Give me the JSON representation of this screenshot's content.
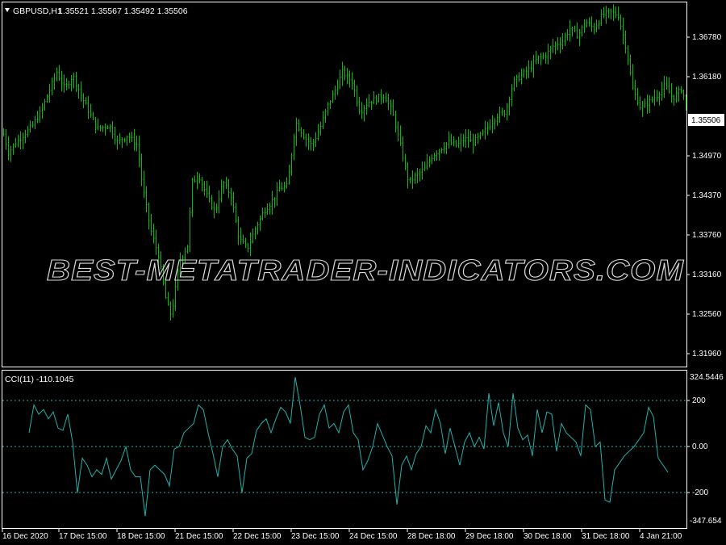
{
  "symbol_header": {
    "title": "GBPUSD,H1",
    "ohlc": "1.35521 1.35567 1.35492 1.35506"
  },
  "watermark": "BEST-METATRADER-INDICATORS.COM",
  "price_axis": {
    "ticks": [
      "1.36780",
      "1.36180",
      "1.34970",
      "1.34370",
      "1.33760",
      "1.33160",
      "1.32560",
      "1.31960"
    ],
    "current_price": "1.35506"
  },
  "indicator": {
    "label": "CCI(11) -110.1045",
    "axis_ticks": [
      "324.5446",
      "200",
      "0.00",
      "-200",
      "-347.654"
    ]
  },
  "time_axis": {
    "ticks": [
      "16 Dec 2020",
      "17 Dec 15:00",
      "18 Dec 15:00",
      "21 Dec 15:00",
      "22 Dec 15:00",
      "23 Dec 15:00",
      "24 Dec 15:00",
      "28 Dec 18:00",
      "29 Dec 18:00",
      "30 Dec 18:00",
      "31 Dec 18:00",
      "4 Jan 21:00"
    ]
  },
  "colors": {
    "background": "#000000",
    "bars": "#00c000",
    "cci_line": "#20b2aa",
    "levels": "#20b2aa",
    "frame": "#ffffff"
  },
  "chart_data": [
    {
      "type": "bar",
      "y_axis_range": [
        1.3166,
        1.3708
      ],
      "close_path": [
        [
          0,
          1.353
        ],
        [
          10,
          1.3485
        ],
        [
          20,
          1.35
        ],
        [
          40,
          1.3525
        ],
        [
          50,
          1.3545
        ],
        [
          60,
          1.3575
        ],
        [
          70,
          1.3605
        ],
        [
          80,
          1.358
        ],
        [
          90,
          1.36
        ],
        [
          100,
          1.357
        ],
        [
          110,
          1.3545
        ],
        [
          120,
          1.352
        ],
        [
          135,
          1.3525
        ],
        [
          145,
          1.35
        ],
        [
          158,
          1.351
        ],
        [
          170,
          1.3495
        ],
        [
          176,
          1.3435
        ],
        [
          186,
          1.337
        ],
        [
          196,
          1.333
        ],
        [
          206,
          1.326
        ],
        [
          212,
          1.324
        ],
        [
          222,
          1.332
        ],
        [
          232,
          1.3345
        ],
        [
          238,
          1.344
        ],
        [
          246,
          1.345
        ],
        [
          256,
          1.342
        ],
        [
          266,
          1.3395
        ],
        [
          276,
          1.344
        ],
        [
          286,
          1.342
        ],
        [
          296,
          1.3355
        ],
        [
          306,
          1.334
        ],
        [
          316,
          1.337
        ],
        [
          326,
          1.3395
        ],
        [
          336,
          1.341
        ],
        [
          346,
          1.343
        ],
        [
          356,
          1.3435
        ],
        [
          366,
          1.353
        ],
        [
          376,
          1.351
        ],
        [
          386,
          1.3495
        ],
        [
          396,
          1.352
        ],
        [
          406,
          1.3555
        ],
        [
          416,
          1.358
        ],
        [
          424,
          1.3605
        ],
        [
          436,
          1.359
        ],
        [
          446,
          1.3545
        ],
        [
          456,
          1.356
        ],
        [
          466,
          1.3565
        ],
        [
          476,
          1.357
        ],
        [
          486,
          1.3545
        ],
        [
          496,
          1.3495
        ],
        [
          506,
          1.344
        ],
        [
          516,
          1.345
        ],
        [
          526,
          1.346
        ],
        [
          536,
          1.348
        ],
        [
          546,
          1.349
        ],
        [
          556,
          1.35
        ],
        [
          566,
          1.3495
        ],
        [
          576,
          1.3505
        ],
        [
          586,
          1.35
        ],
        [
          596,
          1.351
        ],
        [
          606,
          1.3525
        ],
        [
          616,
          1.354
        ],
        [
          626,
          1.3545
        ],
        [
          636,
          1.359
        ],
        [
          646,
          1.36
        ],
        [
          656,
          1.361
        ],
        [
          666,
          1.3625
        ],
        [
          676,
          1.363
        ],
        [
          686,
          1.3645
        ],
        [
          696,
          1.365
        ],
        [
          706,
          1.367
        ],
        [
          716,
          1.366
        ],
        [
          726,
          1.368
        ],
        [
          736,
          1.367
        ],
        [
          746,
          1.369
        ],
        [
          756,
          1.3695
        ],
        [
          766,
          1.369
        ],
        [
          776,
          1.364
        ],
        [
          784,
          1.358
        ],
        [
          794,
          1.355
        ],
        [
          804,
          1.356
        ],
        [
          814,
          1.357
        ],
        [
          824,
          1.3585
        ],
        [
          834,
          1.3565
        ],
        [
          844,
          1.358
        ],
        [
          852,
          1.3551
        ]
      ]
    },
    {
      "type": "line",
      "y_axis_range": [
        -347.654,
        324.5446
      ],
      "levels": [
        200,
        0,
        -200
      ],
      "x": [
        36,
        42,
        48,
        54,
        60,
        66,
        72,
        78,
        84,
        90,
        96,
        102,
        108,
        114,
        120,
        126,
        132,
        138,
        144,
        150,
        156,
        162,
        168,
        174,
        180,
        186,
        192,
        198,
        204,
        210,
        216,
        222,
        228,
        234,
        240,
        246,
        252,
        258,
        264,
        270,
        276,
        282,
        288,
        294,
        300,
        306,
        312,
        318,
        324,
        330,
        336,
        342,
        348,
        354,
        360,
        366,
        372,
        378,
        384,
        390,
        396,
        402,
        408,
        414,
        420,
        426,
        432,
        438,
        444,
        450,
        456,
        462,
        468,
        474,
        480,
        486,
        492,
        498,
        504,
        510,
        516,
        522,
        528,
        534,
        540,
        546,
        552,
        558,
        564,
        570,
        576,
        582,
        588,
        594,
        600,
        606,
        612,
        618,
        624,
        630,
        636,
        642,
        648,
        654,
        660,
        666,
        672,
        678,
        684,
        690,
        696,
        702,
        708,
        714,
        720,
        726,
        732,
        738,
        744,
        750,
        756,
        762,
        768,
        774,
        780,
        786,
        792,
        798,
        804,
        810,
        816,
        822,
        828,
        834,
        840,
        846,
        850
      ],
      "values": [
        60,
        180,
        140,
        160,
        120,
        150,
        80,
        70,
        140,
        20,
        -200,
        -50,
        -80,
        -130,
        -100,
        -120,
        -50,
        -140,
        -100,
        -60,
        0,
        -100,
        -130,
        -130,
        -300,
        -100,
        -80,
        -100,
        -120,
        -170,
        -10,
        0,
        60,
        80,
        100,
        180,
        160,
        60,
        -30,
        -130,
        0,
        30,
        -10,
        -40,
        -200,
        -50,
        -30,
        70,
        100,
        120,
        60,
        120,
        170,
        150,
        100,
        300,
        180,
        40,
        30,
        40,
        140,
        180,
        80,
        100,
        60,
        150,
        180,
        60,
        30,
        -100,
        -60,
        0,
        100,
        50,
        0,
        -40,
        -250,
        -80,
        -40,
        -100,
        -30,
        0,
        90,
        60,
        160,
        100,
        -30,
        80,
        0,
        -80,
        20,
        60,
        0,
        40,
        -10,
        230,
        90,
        190,
        60,
        0,
        230,
        80,
        30,
        50,
        -40,
        160,
        60,
        150,
        140,
        -20,
        100,
        60,
        40,
        20,
        -40,
        180,
        160,
        0,
        20,
        -230,
        -240,
        -100,
        -70,
        -40,
        -20,
        0,
        30,
        60,
        170,
        130,
        -50,
        -80,
        -110
      ]
    }
  ]
}
